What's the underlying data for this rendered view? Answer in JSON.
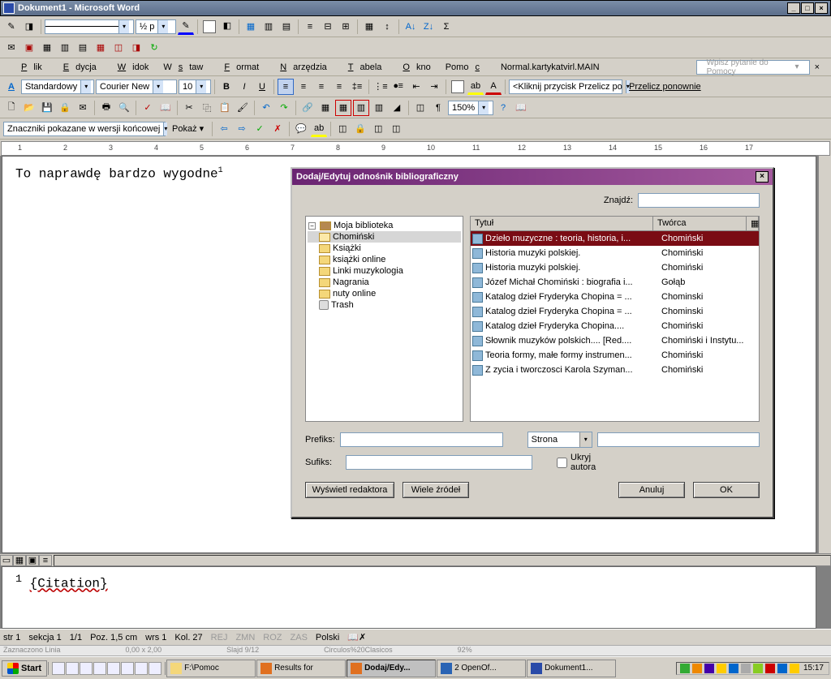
{
  "window": {
    "title": "Dokument1 - Microsoft Word"
  },
  "menu": {
    "items": [
      "Plik",
      "Edycja",
      "Widok",
      "Wstaw",
      "Format",
      "Narzędzia",
      "Tabela",
      "Okno",
      "Pomoc",
      "Normal.kartykatvirl.MAIN"
    ],
    "help_placeholder": "Wpisz pytanie do Pomocy"
  },
  "format_bar": {
    "style": "Standardowy",
    "font": "Courier New",
    "size": "10",
    "recalc_hint": "<Kliknij przycisk Przelicz po",
    "recalc_btn": "Przelicz ponownie"
  },
  "zoom": "150%",
  "markup_bar": {
    "mode": "Znaczniki pokazane w wersji końcowej",
    "show": "Pokaż"
  },
  "ruler_marks": [
    "1",
    "2",
    "3",
    "4",
    "5",
    "6",
    "7",
    "8",
    "9",
    "10",
    "11",
    "12",
    "13",
    "14",
    "15",
    "16",
    "17"
  ],
  "doc": {
    "line": "To naprawdę bardzo wygodne",
    "sup": "1"
  },
  "lower": {
    "sup": "1",
    "citation": "{Citation}"
  },
  "status": {
    "page": "str 1",
    "section": "sekcja 1",
    "pages": "1/1",
    "pos": "Poz. 1,5 cm",
    "line": "wrs 1",
    "col": "Kol. 27",
    "flags": [
      "REJ",
      "ZMN",
      "ROZ",
      "ZAS"
    ],
    "lang": "Polski"
  },
  "cutstrip": [
    "Zaznaczono Linia",
    "0,00 x 2,00",
    "Slajd 9/12",
    "Circulos%20Clasicos",
    "92%"
  ],
  "dialog": {
    "title": "Dodaj/Edytuj odnośnik bibliograficzny",
    "find_label": "Znajdź:",
    "tree_root": "Moja biblioteka",
    "tree_items": [
      "Chomiński",
      "Książki",
      "książki online",
      "Linki muzykologia",
      "Nagrania",
      "nuty online",
      "Trash"
    ],
    "columns": {
      "title": "Tytuł",
      "creator": "Twórca"
    },
    "rows": [
      {
        "t": "Dzieło muzyczne : teoria, historia, i...",
        "c": "Chomiński",
        "sel": true
      },
      {
        "t": "Historia muzyki polskiej.",
        "c": "Chomiński"
      },
      {
        "t": "Historia muzyki polskiej.",
        "c": "Chomiński"
      },
      {
        "t": "Józef Michał Chomiński : biografia i...",
        "c": "Gołąb"
      },
      {
        "t": "Katalog dzieł Fryderyka Chopina = ...",
        "c": "Chominski"
      },
      {
        "t": "Katalog dzieł Fryderyka Chopina = ...",
        "c": "Chominski"
      },
      {
        "t": "Katalog dzieł Fryderyka Chopina....",
        "c": "Chomiński"
      },
      {
        "t": "Słownik muzyków polskich.... [Red....",
        "c": "Chomiński i Instytu..."
      },
      {
        "t": "Teoria formy, małe formy instrumen...",
        "c": "Chomiński"
      },
      {
        "t": "Z zycia i tworczosci Karola Szyman...",
        "c": "Chomiński"
      }
    ],
    "prefix_label": "Prefiks:",
    "suffix_label": "Sufiks:",
    "locator_type": "Strona",
    "hide_author": "Ukryj autora",
    "show_editor": "Wyświetl redaktora",
    "multi": "Wiele źródeł",
    "cancel": "Anuluj",
    "ok": "OK"
  },
  "taskbar": {
    "start": "Start",
    "tasks": [
      {
        "label": "F:\\Pomoc",
        "icon": "#f4d77a"
      },
      {
        "label": "Results for",
        "icon": "#e07020"
      },
      {
        "label": "Dodaj/Edy...",
        "icon": "#e07020",
        "active": true
      },
      {
        "label": "2 OpenOf...",
        "icon": "#2a64b4"
      },
      {
        "label": "Dokument1...",
        "icon": "#2a4ba8"
      }
    ],
    "clock": "15:17"
  }
}
